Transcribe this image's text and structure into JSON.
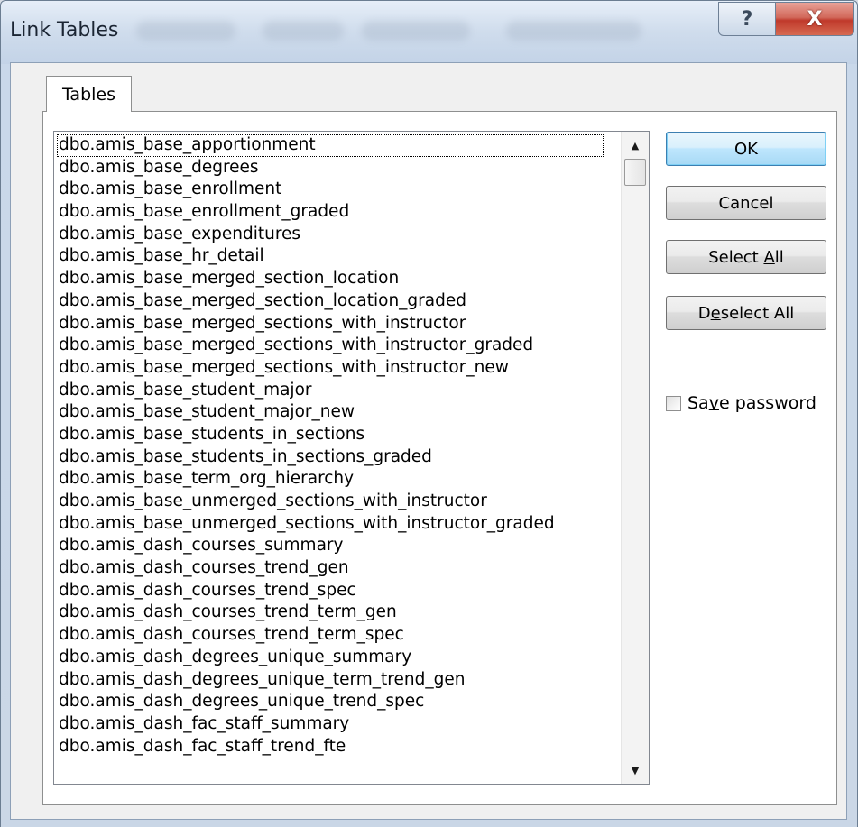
{
  "window": {
    "title": "Link Tables",
    "help_label": "?",
    "close_label": "X"
  },
  "tab": {
    "label": "Tables"
  },
  "tables": [
    "dbo.amis_base_apportionment",
    "dbo.amis_base_degrees",
    "dbo.amis_base_enrollment",
    "dbo.amis_base_enrollment_graded",
    "dbo.amis_base_expenditures",
    "dbo.amis_base_hr_detail",
    "dbo.amis_base_merged_section_location",
    "dbo.amis_base_merged_section_location_graded",
    "dbo.amis_base_merged_sections_with_instructor",
    "dbo.amis_base_merged_sections_with_instructor_graded",
    "dbo.amis_base_merged_sections_with_instructor_new",
    "dbo.amis_base_student_major",
    "dbo.amis_base_student_major_new",
    "dbo.amis_base_students_in_sections",
    "dbo.amis_base_students_in_sections_graded",
    "dbo.amis_base_term_org_hierarchy",
    "dbo.amis_base_unmerged_sections_with_instructor",
    "dbo.amis_base_unmerged_sections_with_instructor_graded",
    "dbo.amis_dash_courses_summary",
    "dbo.amis_dash_courses_trend_gen",
    "dbo.amis_dash_courses_trend_spec",
    "dbo.amis_dash_courses_trend_term_gen",
    "dbo.amis_dash_courses_trend_term_spec",
    "dbo.amis_dash_degrees_unique_summary",
    "dbo.amis_dash_degrees_unique_term_trend_gen",
    "dbo.amis_dash_degrees_unique_trend_spec",
    "dbo.amis_dash_fac_staff_summary",
    "dbo.amis_dash_fac_staff_trend_fte"
  ],
  "buttons": {
    "ok": "OK",
    "cancel": "Cancel",
    "select_all_pre": "Select ",
    "select_all_mnemonic": "A",
    "select_all_post": "ll",
    "deselect_all_pre": "D",
    "deselect_all_mnemonic": "e",
    "deselect_all_post": "select All"
  },
  "save_password": {
    "pre": "Sa",
    "mnemonic": "v",
    "post": "e password",
    "checked": false
  },
  "colors": {
    "default_button_border": "#3c7fb1",
    "close_button": "#c0392b"
  }
}
